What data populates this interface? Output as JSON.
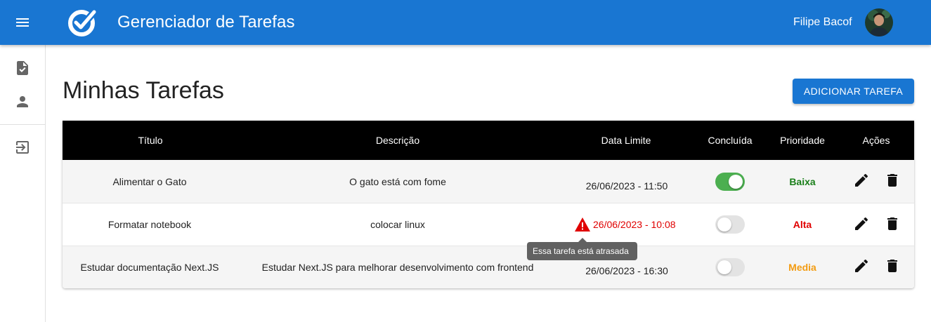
{
  "header": {
    "app_title": "Gerenciador de Tarefas",
    "user_name": "Filipe Bacof",
    "brand_color": "#1976d2",
    "menu_icon": "menu-icon",
    "logo_icon": "check-circle-logo"
  },
  "sidebar": {
    "items": [
      {
        "icon": "task-file-icon"
      },
      {
        "icon": "person-icon"
      },
      {
        "icon": "logout-icon"
      }
    ]
  },
  "main": {
    "page_title": "Minhas Tarefas",
    "add_button": "ADICIONAR TAREFA"
  },
  "table": {
    "columns": [
      "Título",
      "Descrição",
      "Data Limite",
      "Concluída",
      "Prioridade",
      "Ações"
    ],
    "rows": [
      {
        "titulo": "Alimentar o Gato",
        "descricao": "O gato está com fome",
        "data_limite": "26/06/2023 - 11:50",
        "concluida": true,
        "prioridade": "Baixa",
        "prioridade_color": "#1a7f1a",
        "atrasada": false
      },
      {
        "titulo": "Formatar notebook",
        "descricao": "colocar linux",
        "data_limite": "26/06/2023 - 10:08",
        "concluida": false,
        "prioridade": "Alta",
        "prioridade_color": "#e00000",
        "atrasada": true
      },
      {
        "titulo": "Estudar documentação Next.JS",
        "descricao": "Estudar Next.JS para melhorar desenvolvimento com frontend",
        "data_limite": "26/06/2023 - 16:30",
        "concluida": false,
        "prioridade": "Media",
        "prioridade_color": "#f39c12",
        "atrasada": false
      }
    ]
  },
  "tooltip": {
    "text": "Essa tarefa está atrasada"
  }
}
